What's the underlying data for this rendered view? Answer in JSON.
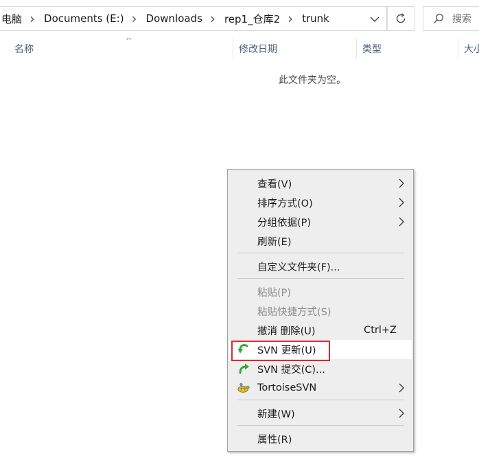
{
  "address_bar": {
    "breadcrumbs": [
      "电脑",
      "Documents (E:)",
      "Downloads",
      "rep1_仓库2",
      "trunk"
    ],
    "search_placeholder": "搜索"
  },
  "columns": {
    "name": "名称",
    "date_modified": "修改日期",
    "type": "类型",
    "size": "大小"
  },
  "empty_message": "此文件夹为空。",
  "context_menu": {
    "items": [
      {
        "label": "查看(V)",
        "submenu": true
      },
      {
        "label": "排序方式(O)",
        "submenu": true
      },
      {
        "label": "分组依据(P)",
        "submenu": true
      },
      {
        "label": "刷新(E)"
      },
      {
        "label": "自定义文件夹(F)..."
      },
      {
        "label": "粘贴(P)",
        "disabled": true
      },
      {
        "label": "粘贴快捷方式(S)",
        "disabled": true
      },
      {
        "label": "撤消 删除(U)",
        "shortcut": "Ctrl+Z"
      },
      {
        "label": "SVN 更新(U)",
        "icon": "svn-update-icon",
        "highlighted": true
      },
      {
        "label": "SVN 提交(C)...",
        "icon": "svn-commit-icon"
      },
      {
        "label": "TortoiseSVN",
        "icon": "tortoisesvn-icon",
        "submenu": true
      },
      {
        "label": "新建(W)",
        "submenu": true
      },
      {
        "label": "属性(R)"
      }
    ]
  },
  "colors": {
    "menu_background": "#eeeeee",
    "highlight_border": "#e0282e",
    "svn_green": "#3aa635",
    "column_header_text": "#4c607a"
  }
}
